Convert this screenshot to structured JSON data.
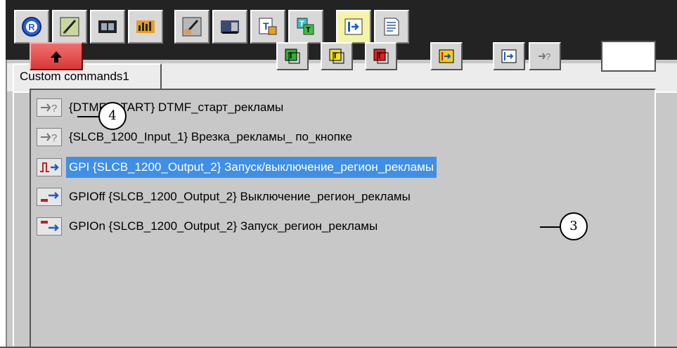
{
  "toolbar": {
    "buttons": [
      {
        "icon": "registered-icon",
        "active": false
      },
      {
        "icon": "brush-icon",
        "active": false
      },
      {
        "icon": "filmstrip-icon",
        "active": false
      },
      {
        "icon": "level-meter-icon",
        "active": false
      },
      {
        "icon": "paint-edit-icon",
        "active": false
      },
      {
        "icon": "video-clip-icon",
        "active": false
      },
      {
        "icon": "text-template-icon",
        "active": false
      },
      {
        "icon": "text-layers-icon",
        "active": false
      },
      {
        "icon": "command-execute-icon",
        "active": true
      },
      {
        "icon": "document-icon",
        "active": false
      }
    ]
  },
  "tab": {
    "label": "Custom commands1"
  },
  "secondary_toolbar": {
    "up_button_icon": "arrow-up-icon",
    "buttons": [
      "text-green-icon",
      "text-yellow-icon",
      "text-red-icon",
      "gpi-command-icon",
      "command-run-icon",
      "command-query-icon"
    ]
  },
  "list": {
    "items": [
      {
        "text": "{DTMF_START} DTMF_старт_рекламы",
        "icon": "query-arrow-icon",
        "selected": false
      },
      {
        "text": "{SLCB_1200_Input_1} Врезка_рекламы_ по_кнопке",
        "icon": "query-arrow-icon",
        "selected": false
      },
      {
        "text": "GPI {SLCB_1200_Output_2} Запуск/выключение_регион_рекламы",
        "icon": "gpi-pulse-icon",
        "selected": true
      },
      {
        "text": "GPIOff {SLCB_1200_Output_2} Выключение_регион_рекламы",
        "icon": "gpi-off-icon",
        "selected": false
      },
      {
        "text": "GPIOn {SLCB_1200_Output_2} Запуск_регион_рекламы",
        "icon": "gpi-on-icon",
        "selected": false
      }
    ]
  },
  "callouts": {
    "up_button": "4",
    "selected_item": "3"
  },
  "colors": {
    "selection": "#3f8fe6",
    "up_button": "#e04848",
    "toolbar_bg": "#232323",
    "active_button": "#f4f4a8"
  }
}
